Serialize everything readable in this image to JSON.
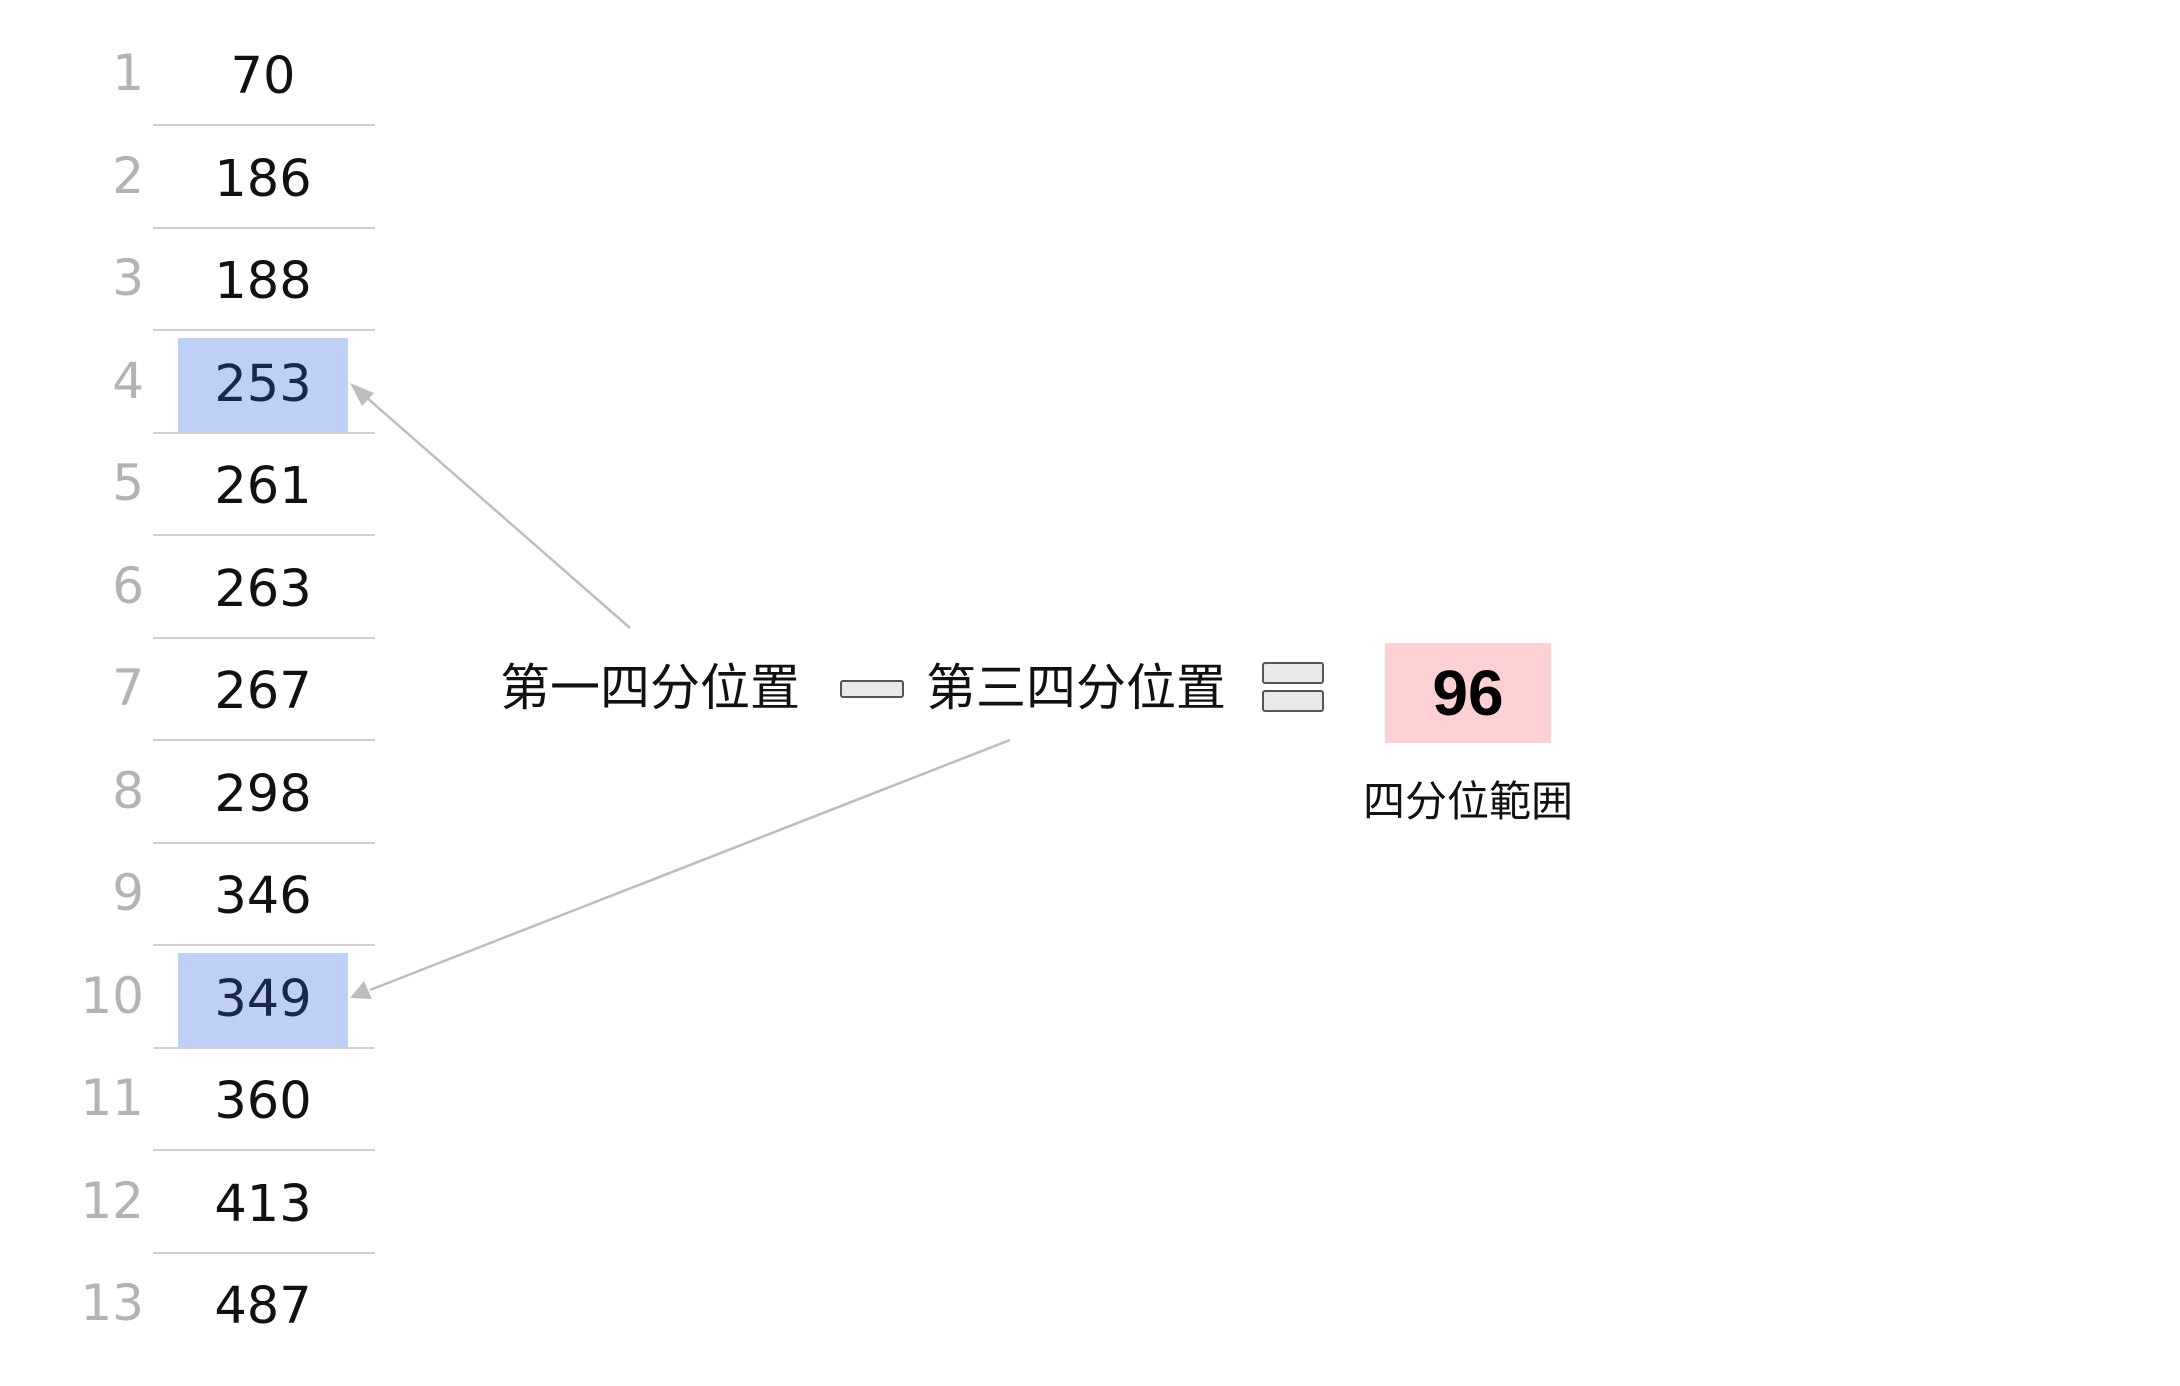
{
  "rows": [
    {
      "index": "1",
      "value": "70",
      "highlight": false
    },
    {
      "index": "2",
      "value": "186",
      "highlight": false
    },
    {
      "index": "3",
      "value": "188",
      "highlight": false
    },
    {
      "index": "4",
      "value": "253",
      "highlight": true
    },
    {
      "index": "5",
      "value": "261",
      "highlight": false
    },
    {
      "index": "6",
      "value": "263",
      "highlight": false
    },
    {
      "index": "7",
      "value": "267",
      "highlight": false
    },
    {
      "index": "8",
      "value": "298",
      "highlight": false
    },
    {
      "index": "9",
      "value": "346",
      "highlight": false
    },
    {
      "index": "10",
      "value": "349",
      "highlight": true
    },
    {
      "index": "11",
      "value": "360",
      "highlight": false
    },
    {
      "index": "12",
      "value": "413",
      "highlight": false
    },
    {
      "index": "13",
      "value": "487",
      "highlight": false
    }
  ],
  "formula": {
    "first_quartile_label": "第一四分位置",
    "third_quartile_label": "第三四分位置"
  },
  "result": {
    "value": "96",
    "caption": "四分位範囲"
  },
  "colors": {
    "highlight": "#bfd0f7",
    "result_bg": "#fdd1d3",
    "index_text": "#b3b3b3",
    "arrow": "#bdbdbd"
  },
  "icons": {
    "operator_1": "minus-sign",
    "operator_2": "equals-sign"
  }
}
